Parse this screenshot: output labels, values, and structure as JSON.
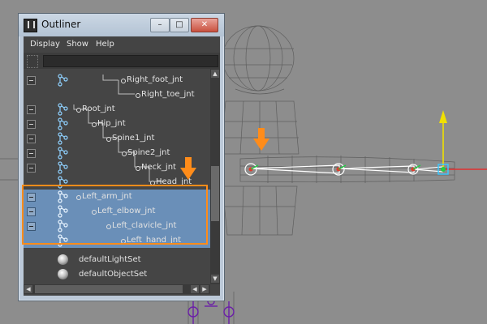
{
  "window": {
    "title": "Outliner",
    "minimize": "–",
    "maximize": "□",
    "close": "✕"
  },
  "menu": [
    "Display",
    "Show",
    "Help"
  ],
  "search": {
    "placeholder": ""
  },
  "rows": [
    {
      "label": "Right_foot_jnt",
      "type": "joint",
      "expander": true,
      "selected": false
    },
    {
      "label": "Right_toe_jnt",
      "type": "joint",
      "expander": false,
      "selected": false
    },
    {
      "label": "Root_jnt",
      "type": "joint",
      "expander": true,
      "selected": false
    },
    {
      "label": "Hip_jnt",
      "type": "joint",
      "expander": true,
      "selected": false
    },
    {
      "label": "Spine1_jnt",
      "type": "joint",
      "expander": true,
      "selected": false
    },
    {
      "label": "Spine2_jnt",
      "type": "joint",
      "expander": true,
      "selected": false
    },
    {
      "label": "Neck_jnt",
      "type": "joint",
      "expander": true,
      "selected": false
    },
    {
      "label": "Head_jnt",
      "type": "joint",
      "expander": false,
      "selected": false
    },
    {
      "label": "Left_arm_jnt",
      "type": "joint",
      "expander": true,
      "selected": true
    },
    {
      "label": "Left_elbow_jnt",
      "type": "joint",
      "expander": true,
      "selected": true
    },
    {
      "label": "Left_clavicle_jnt",
      "type": "joint",
      "expander": true,
      "selected": true
    },
    {
      "label": "Left_hand_jnt",
      "type": "joint",
      "expander": false,
      "selected": true
    },
    {
      "label": "defaultLightSet",
      "type": "set",
      "expander": false,
      "selected": false
    },
    {
      "label": "defaultObjectSet",
      "type": "set",
      "expander": false,
      "selected": false
    }
  ],
  "colors": {
    "highlight": "#ff8c1a",
    "selection": "#6a8fb8",
    "manipulator_y": "#f0e000",
    "manipulator_x": "#e03030",
    "manipulator_center": "#3cc8ff"
  }
}
